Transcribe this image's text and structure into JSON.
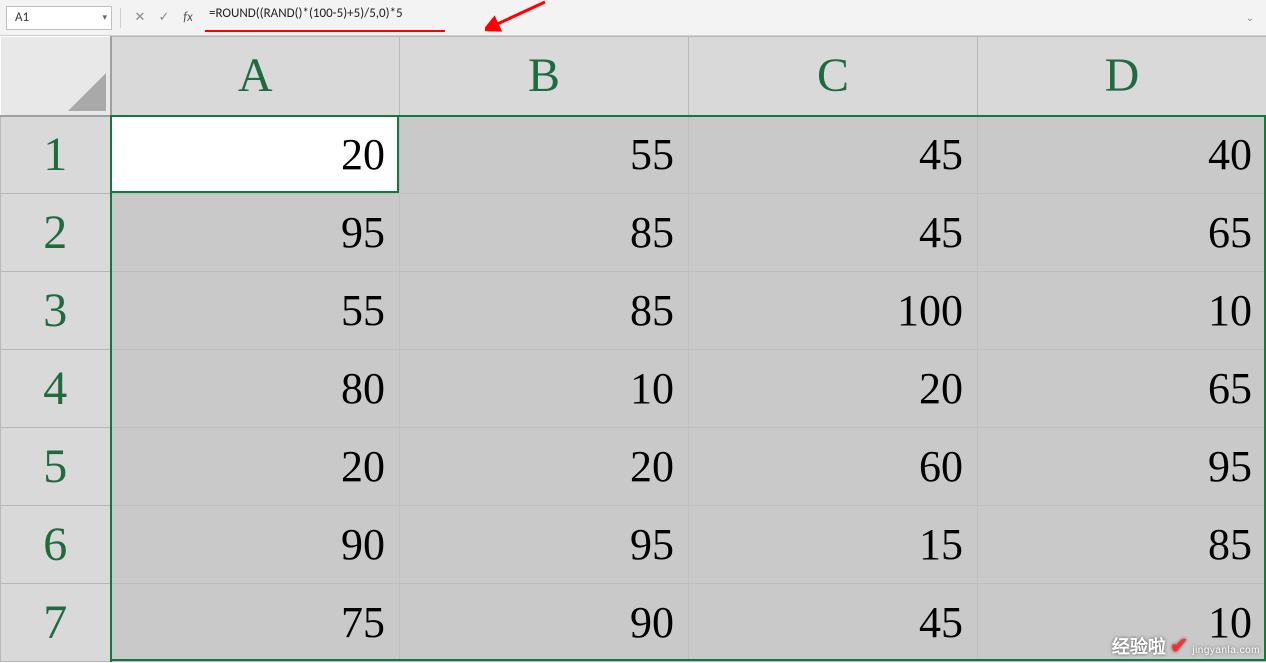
{
  "formula_bar": {
    "cell_ref": "A1",
    "formula": "=ROUND((RAND()*(100-5)+5)/5,0)*5",
    "cancel_icon": "✕",
    "enter_icon": "✓",
    "fx_label": "fx",
    "expand_icon": "⌄",
    "dropdown_icon": "▾"
  },
  "columns": [
    "A",
    "B",
    "C",
    "D"
  ],
  "rows": [
    "1",
    "2",
    "3",
    "4",
    "5",
    "6",
    "7"
  ],
  "cells": [
    [
      "20",
      "55",
      "45",
      "40"
    ],
    [
      "95",
      "85",
      "45",
      "65"
    ],
    [
      "55",
      "85",
      "100",
      "10"
    ],
    [
      "80",
      "10",
      "20",
      "65"
    ],
    [
      "20",
      "20",
      "60",
      "95"
    ],
    [
      "90",
      "95",
      "15",
      "85"
    ],
    [
      "75",
      "90",
      "45",
      "10"
    ]
  ],
  "active_cell": {
    "row": 0,
    "col": 0
  },
  "watermark": {
    "text": "经验啦",
    "url": "jingyanla.com"
  }
}
